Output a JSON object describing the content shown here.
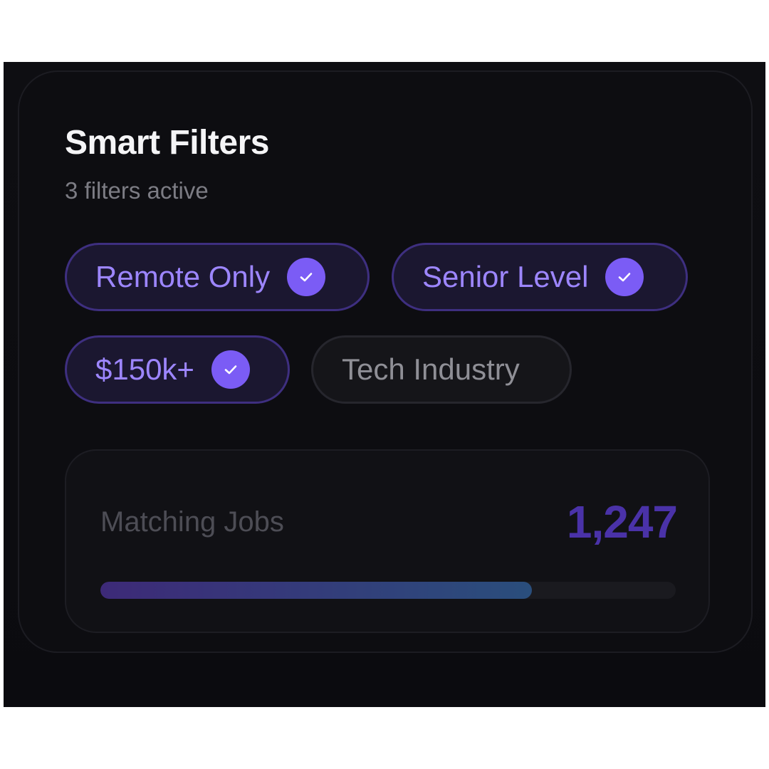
{
  "colors": {
    "accent": "#7b5cf5",
    "progress_start": "#3d2a78",
    "progress_end": "#2a4e7c"
  },
  "header": {
    "title": "Smart Filters",
    "subtitle": "3 filters active"
  },
  "filters": [
    {
      "label": "Remote Only",
      "active": true,
      "icon": "check-icon"
    },
    {
      "label": "Senior Level",
      "active": true,
      "icon": "check-icon"
    },
    {
      "label": "$150k+",
      "active": true,
      "icon": "check-icon"
    },
    {
      "label": "Tech Industry",
      "active": false
    }
  ],
  "matching": {
    "label": "Matching Jobs",
    "count": "1,247",
    "progress_fraction": 0.75
  }
}
